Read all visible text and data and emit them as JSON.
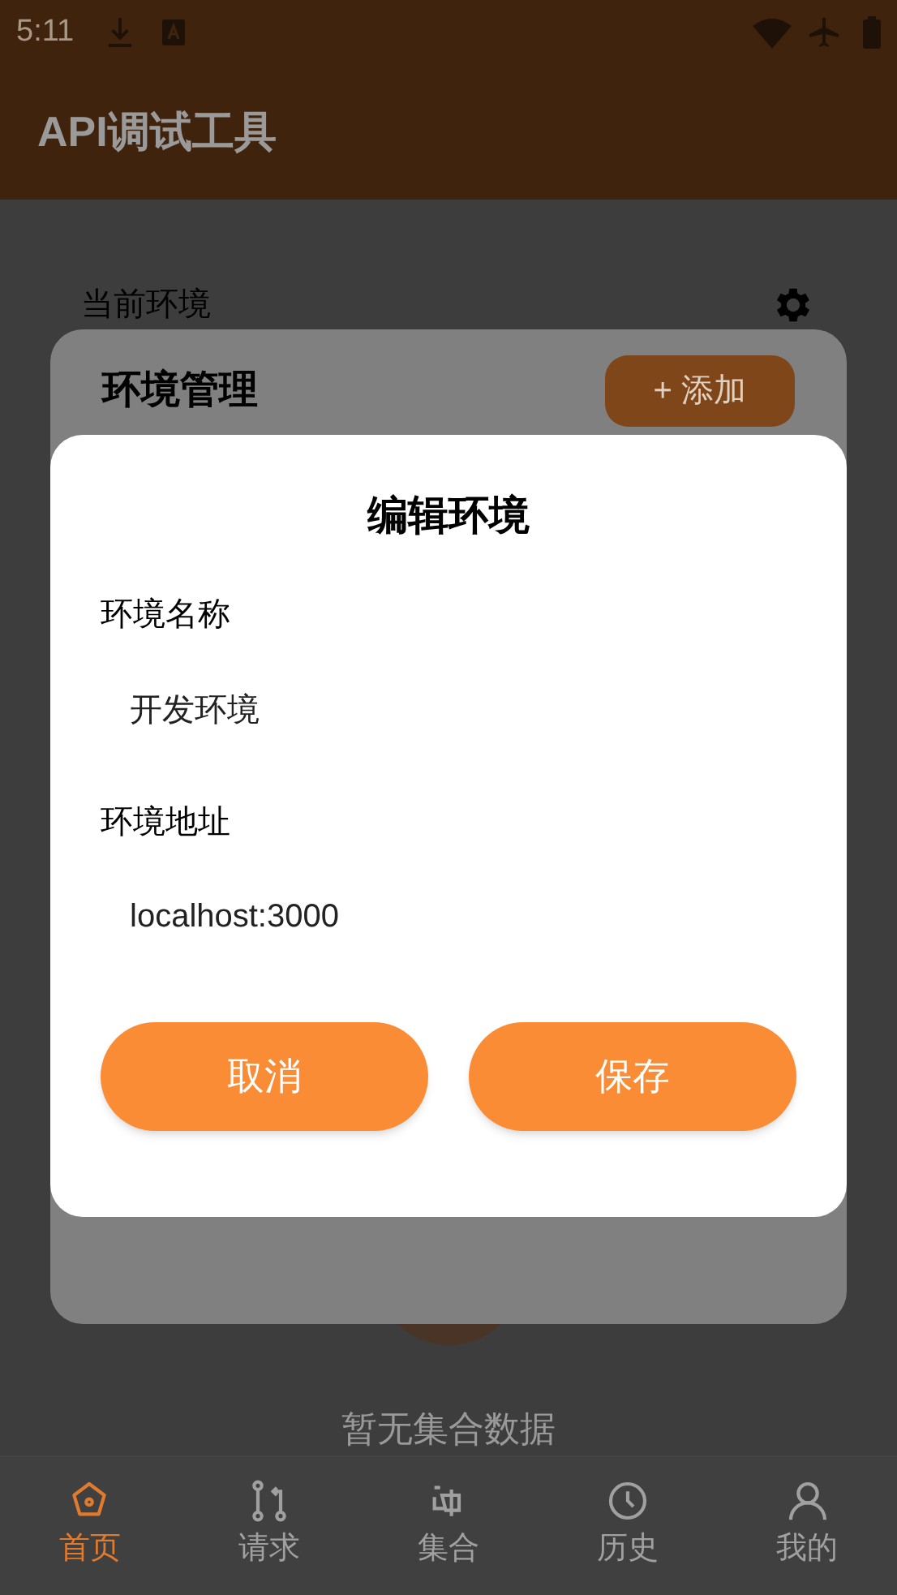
{
  "status_bar": {
    "time": "5:11"
  },
  "app_bar": {
    "title": "API调试工具"
  },
  "environment": {
    "label": "当前环境"
  },
  "empty_state": {
    "text": "暂无集合数据"
  },
  "bottom_nav": [
    {
      "label": "首页",
      "selected": true
    },
    {
      "label": "请求",
      "selected": false
    },
    {
      "label": "集合",
      "selected": false
    },
    {
      "label": "历史",
      "selected": false
    },
    {
      "label": "我的",
      "selected": false
    }
  ],
  "env_sheet": {
    "title": "环境管理",
    "add_button": "+ 添加"
  },
  "dialog": {
    "title": "编辑环境",
    "fields": [
      {
        "label": "环境名称",
        "value": "开发环境"
      },
      {
        "label": "环境地址",
        "value": "localhost:3000"
      }
    ],
    "buttons": [
      "取消",
      "保存"
    ]
  }
}
